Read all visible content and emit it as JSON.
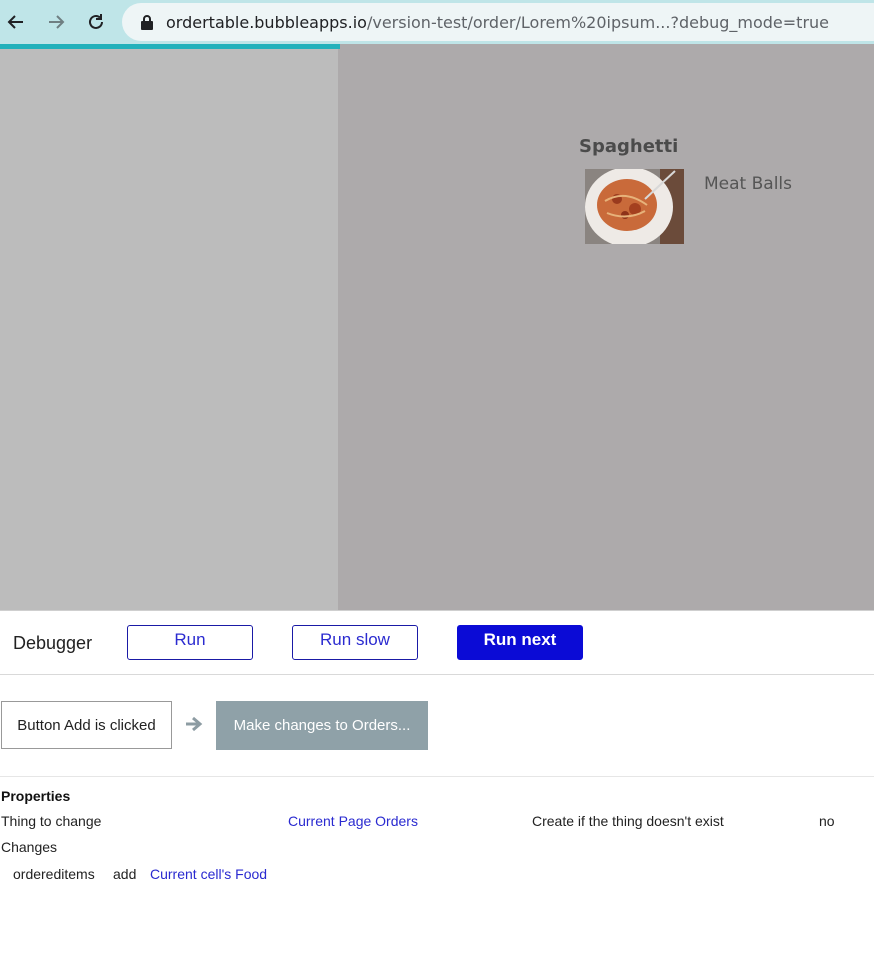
{
  "browser": {
    "url_host": "ordertable.bubbleapps.io",
    "url_rest": "/version-test/order/Lorem%20ipsum...?debug_mode=true"
  },
  "app": {
    "food_title": "Spaghetti",
    "food_subtitle": "Meat Balls",
    "image_icon": "spaghetti-image"
  },
  "debugger": {
    "title": "Debugger",
    "run_label": "Run",
    "run_slow_label": "Run slow",
    "run_next_label": "Run next",
    "event_label": "Button Add is clicked",
    "action_label": "Make changes to Orders...",
    "properties_heading": "Properties",
    "thing_to_change_label": "Thing to change",
    "thing_to_change_value": "Current Page Orders",
    "create_if_label": "Create if the thing doesn't exist",
    "create_if_value": "no",
    "changes_label": "Changes",
    "change_field": "ordereditems",
    "change_op": "add",
    "change_value": "Current cell's Food"
  },
  "colors": {
    "topbar": "#bfe5e8",
    "app_bg": "#adaaab",
    "accent": "#0b0bd6",
    "loading": "#22b1bb"
  }
}
